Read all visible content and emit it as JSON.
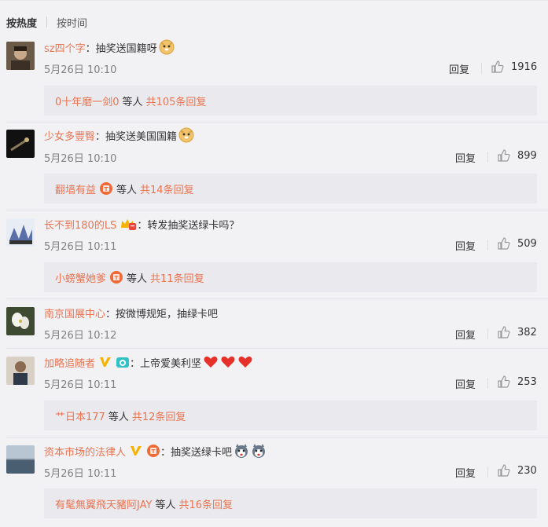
{
  "sort": {
    "hot": "按热度",
    "time": "按时间"
  },
  "reply_label": "回复",
  "etc_label": "等人",
  "colors": {
    "name": "#eb7350",
    "muted": "#808080"
  },
  "comments": [
    {
      "user": "sz四个字",
      "text": "抽奖送国籍呀",
      "emojis": [
        "doge-emoji"
      ],
      "time": "5月26日 10:10",
      "likes": "1916",
      "sub": {
        "who": "0十年磨一剑0",
        "total": "共105条回复"
      }
    },
    {
      "user": "少女多豐臀",
      "text": "抽奖送美国国籍",
      "emojis": [
        "doge-emoji"
      ],
      "time": "5月26日 10:10",
      "likes": "899",
      "sub": {
        "who": "翻墙有益",
        "total": "共14条回复"
      }
    },
    {
      "user": "长不到180的LS",
      "text": "转发抽奖送绿卡吗？",
      "emojis": [],
      "time": "5月26日 10:11",
      "likes": "509",
      "sub": {
        "who": "小螃蟹她爹",
        "total": "共11条回复"
      }
    },
    {
      "user": "南京国展中心",
      "text": "按微博规矩，抽绿卡吧",
      "emojis": [],
      "time": "5月26日 10:12",
      "likes": "382"
    },
    {
      "user": "加略追随者",
      "text": "上帝爱美利坚",
      "emojis": [
        "heart-emoji",
        "heart-emoji",
        "heart-emoji"
      ],
      "time": "5月26日 10:11",
      "likes": "253",
      "sub": {
        "who": "艹日本177",
        "total": "共12条回复"
      }
    },
    {
      "user": "资本市场的法律人",
      "text": "抽奖送绿卡吧",
      "emojis": [
        "husky-emoji",
        "husky-emoji"
      ],
      "time": "5月26日 10:11",
      "likes": "230",
      "sub": {
        "who": "有髦無翼飛天豬阿JAY",
        "total": "共16条回复"
      }
    }
  ]
}
